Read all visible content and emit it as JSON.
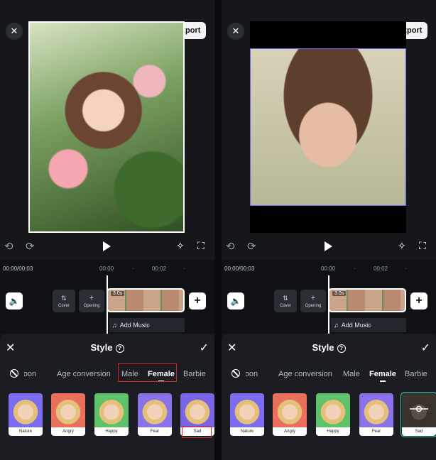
{
  "left": {
    "export_label": "Export",
    "timecode": "00:00/00:03",
    "ticks": [
      "00:00",
      "·",
      "00:02",
      "·"
    ],
    "cover_label": "Cover",
    "opening_label": "Opening",
    "clip_duration": "3.0s",
    "add_music_label": "Add Music",
    "sheet_title": "Style",
    "categories": [
      "Cartoon",
      "Age conversion",
      "Male",
      "Female",
      "Barbie"
    ],
    "thumbnails": [
      "Nature",
      "Angry",
      "Happy",
      "Fear",
      "Sad"
    ]
  },
  "right": {
    "export_label": "Export",
    "timecode": "00:00/00:03",
    "ticks": [
      "00:00",
      "·",
      "00:02",
      "·"
    ],
    "cover_label": "Cover",
    "opening_label": "Opening",
    "clip_duration": "3.0s",
    "add_music_label": "Add Music",
    "sheet_title": "Style",
    "categories": [
      "Cartoon",
      "Age conversion",
      "Male",
      "Female",
      "Barbie"
    ],
    "thumbnails": [
      "Nature",
      "Angry",
      "Happy",
      "Fear",
      "Sad"
    ]
  },
  "colors": {
    "thumb_bg": [
      "#7b6cf0",
      "#e9705d",
      "#5fc26b",
      "#8a73e8",
      "#7a65e6"
    ],
    "selection_ring": "#3ed7c1",
    "highlight_box": "#e02424"
  },
  "icons": {
    "close": "close-icon",
    "export": "upload-icon",
    "undo": "undo-icon",
    "redo": "redo-icon",
    "play": "play-icon",
    "magic": "magic-wand-icon",
    "fullscreen": "fullscreen-icon",
    "mute": "speaker-icon",
    "help": "help-circle-icon",
    "confirm": "check-icon",
    "none": "no-style-icon",
    "music": "music-note-icon"
  }
}
